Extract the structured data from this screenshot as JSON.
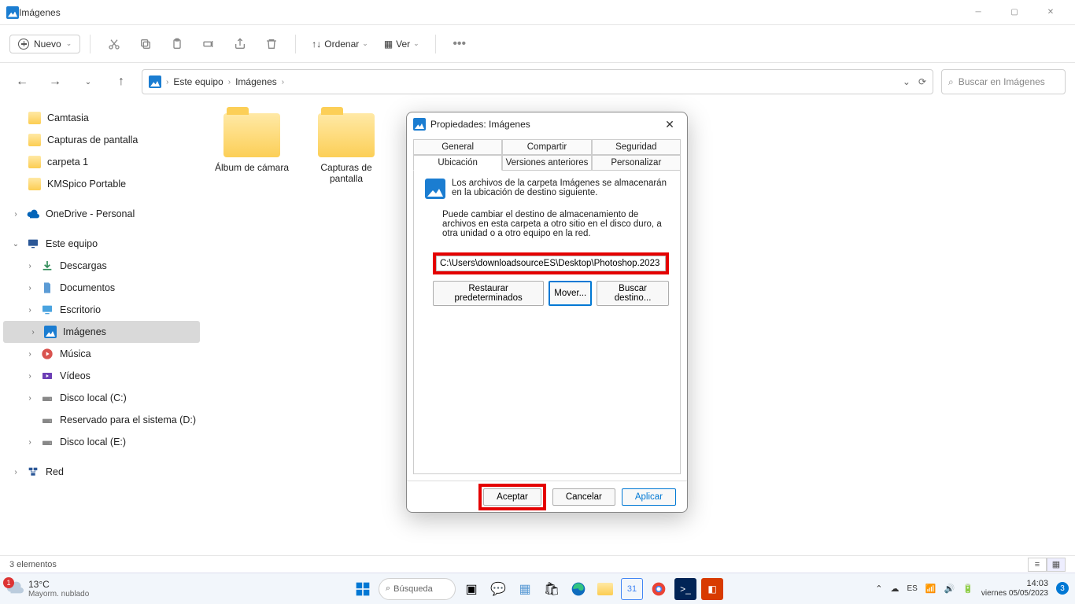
{
  "window": {
    "title": "Imágenes"
  },
  "toolbar": {
    "new": "Nuevo",
    "sort": "Ordenar",
    "view": "Ver"
  },
  "breadcrumb": {
    "root": "Este equipo",
    "current": "Imágenes"
  },
  "search": {
    "placeholder": "Buscar en Imágenes"
  },
  "sidebar": {
    "quick": [
      {
        "label": "Camtasia"
      },
      {
        "label": "Capturas de pantalla"
      },
      {
        "label": "carpeta 1"
      },
      {
        "label": "KMSpico Portable"
      }
    ],
    "onedrive": "OneDrive - Personal",
    "thispc": "Este equipo",
    "thispc_items": [
      {
        "label": "Descargas"
      },
      {
        "label": "Documentos"
      },
      {
        "label": "Escritorio"
      },
      {
        "label": "Imágenes"
      },
      {
        "label": "Música"
      },
      {
        "label": "Vídeos"
      },
      {
        "label": "Disco local (C:)"
      },
      {
        "label": "Reservado para el sistema (D:)"
      },
      {
        "label": "Disco local (E:)"
      }
    ],
    "network": "Red"
  },
  "content": {
    "folders": [
      {
        "name": "Álbum de cámara"
      },
      {
        "name": "Capturas de pantalla"
      }
    ]
  },
  "status": {
    "count": "3 elementos"
  },
  "dialog": {
    "title": "Propiedades: Imágenes",
    "tabs_top": [
      "General",
      "Compartir",
      "Seguridad"
    ],
    "tabs_bottom": [
      "Ubicación",
      "Versiones anteriores",
      "Personalizar"
    ],
    "intro": "Los archivos de la carpeta Imágenes se almacenarán en la ubicación de destino siguiente.",
    "para": "Puede cambiar el destino de almacenamiento de archivos en esta carpeta a otro sitio en el disco duro, a otra unidad o a otro equipo en la red.",
    "path": "C:\\Users\\downloadsourceES\\Desktop\\Photoshop.2023",
    "buttons": {
      "restore": "Restaurar predeterminados",
      "move": "Mover...",
      "find": "Buscar destino..."
    },
    "footer": {
      "ok": "Aceptar",
      "cancel": "Cancelar",
      "apply": "Aplicar"
    }
  },
  "taskbar": {
    "weather_badge": "1",
    "temp": "13°C",
    "weather": "Mayorm. nublado",
    "search": "Búsqueda",
    "time": "14:03",
    "date": "viernes 05/05/2023",
    "notif": "3"
  }
}
